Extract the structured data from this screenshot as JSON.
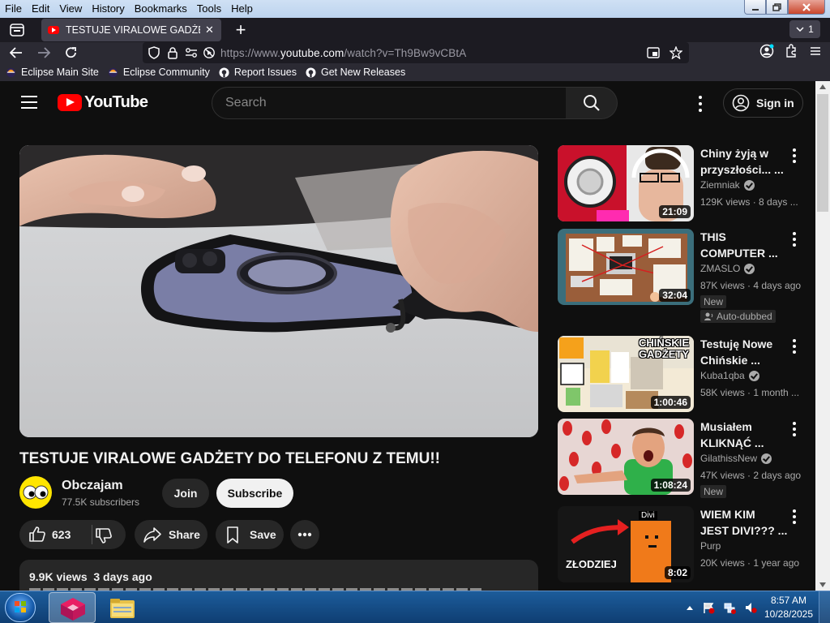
{
  "menu": [
    "File",
    "Edit",
    "View",
    "History",
    "Bookmarks",
    "Tools",
    "Help"
  ],
  "tab": {
    "title": "TESTUJE VIRALOWE GADŻETY D",
    "count": "1"
  },
  "address": {
    "prefix": "https://www.",
    "domain": "youtube.com",
    "path": "/watch?v=Th9Bw9vCBtA"
  },
  "bookmarks": [
    "Eclipse Main Site",
    "Eclipse Community",
    "Report Issues",
    "Get New Releases"
  ],
  "yt": {
    "logo": "YouTube",
    "search_placeholder": "Search",
    "signin": "Sign in"
  },
  "video": {
    "title": "TESTUJE VIRALOWE GADŻETY DO TELEFONU Z TEMU!!",
    "channel": "Obczajam",
    "subscribers": "77.5K subscribers",
    "join": "Join",
    "subscribe": "Subscribe",
    "likes": "623",
    "share": "Share",
    "save": "Save",
    "views_date": "9.9K views  3 days ago"
  },
  "recommendations": [
    {
      "title1": "Chiny żyją w",
      "title2": "przyszłości... ...",
      "channel": "Ziemniak",
      "verified": true,
      "meta": "129K views · 8 days ...",
      "duration": "21:09",
      "badges": []
    },
    {
      "title1": "THIS",
      "title2": "COMPUTER ...",
      "channel": "ZMASLO",
      "verified": true,
      "meta": "87K views · 4 days ago",
      "duration": "32:04",
      "badges": [
        "New",
        "Auto-dubbed"
      ]
    },
    {
      "title1": "Testuję Nowe",
      "title2": "Chińskie ...",
      "channel": "Kuba1qba",
      "verified": true,
      "meta": "58K views · 1 month ...",
      "duration": "1:00:46",
      "badges": []
    },
    {
      "title1": "Musiałem",
      "title2": "KLIKNĄĆ ...",
      "channel": "GilathissNew",
      "verified": true,
      "meta": "47K views · 2 days ago",
      "duration": "1:08:24",
      "badges": [
        "New"
      ]
    },
    {
      "title1": "WIEM KIM",
      "title2": "JEST DIVI??? ...",
      "channel": "Purp",
      "verified": false,
      "meta": "20K views · 1 year ago",
      "duration": "8:02",
      "badges": []
    }
  ],
  "thumb_text": {
    "t4_label": "Divi",
    "t4_caption": "ZŁODZIEJ",
    "t3_caption": "CHIŃSKIE GADŻETY"
  },
  "taskbar": {
    "time": "8:57 AM",
    "date": "10/28/2025"
  }
}
